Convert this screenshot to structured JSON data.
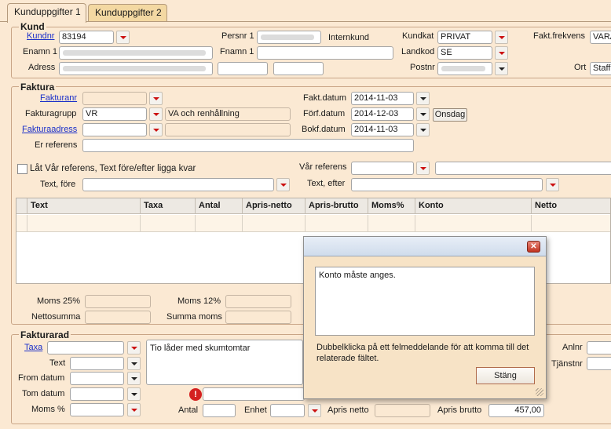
{
  "tabs": [
    "Kunduppgifter 1",
    "Kunduppgifter 2"
  ],
  "kund": {
    "title": "Kund",
    "kundnr_label": "Kundnr",
    "kundnr_value": "83194",
    "persnr_label": "Persnr 1",
    "internkund_label": "Internkund",
    "kundkat_label": "Kundkat",
    "kundkat_value": "PRIVAT",
    "fakt_frekvens_label": "Fakt.frekvens",
    "fakt_frekvens_value": "VARA",
    "enamn_label": "Enamn 1",
    "fnamn_label": "Fnamn 1",
    "landkod_label": "Landkod",
    "landkod_value": "SE",
    "adress_label": "Adress",
    "postnr_label": "Postnr",
    "ort_label": "Ort",
    "ort_value": "Staff"
  },
  "faktura": {
    "title": "Faktura",
    "fakturanr_label": "Fakturanr",
    "fakt_datum_label": "Fakt.datum",
    "fakt_datum_value": "2014-11-03",
    "fakturagrupp_label": "Fakturagrupp",
    "fakturagrupp_value": "VR",
    "fakturagrupp_desc": "VA och renhållning",
    "forf_datum_label": "Förf.datum",
    "forf_datum_value": "2014-12-03",
    "weekday_button": "Onsdag",
    "fakturaadress_label": "Fakturaadress",
    "bokf_datum_label": "Bokf.datum",
    "bokf_datum_value": "2014-11-03",
    "er_referens_label": "Er referens",
    "keep_label": "Låt Vår referens, Text före/efter ligga kvar",
    "var_referens_label": "Vår referens",
    "text_fore_label": "Text, före",
    "text_efter_label": "Text, efter"
  },
  "grid": {
    "columns": [
      "Text",
      "Taxa",
      "Antal",
      "Apris-netto",
      "Apris-brutto",
      "Moms%",
      "Konto",
      "Netto"
    ]
  },
  "totals": {
    "moms25_label": "Moms 25%",
    "moms12_label": "Moms 12%",
    "nettosumma_label": "Nettosumma",
    "summa_moms_label": "Summa moms"
  },
  "fakturarad": {
    "title": "Fakturarad",
    "taxa_label": "Taxa",
    "text_label": "Text",
    "from_datum_label": "From datum",
    "tom_datum_label": "Tom datum",
    "moms_label": "Moms %",
    "description": "Tio låder med skumtomtar",
    "antal_label": "Antal",
    "enhet_label": "Enhet",
    "apris_netto_label": "Apris netto",
    "apris_brutto_label": "Apris brutto",
    "apris_brutto_value": "457,00",
    "anlnr_label": "Anlnr",
    "tjanstnr_label": "Tjänstnr"
  },
  "dialog": {
    "message": "Konto måste anges.",
    "help": "Dubbelklicka på ett felmeddelande för att komma till det relaterade fältet.",
    "close_button": "Stäng"
  }
}
